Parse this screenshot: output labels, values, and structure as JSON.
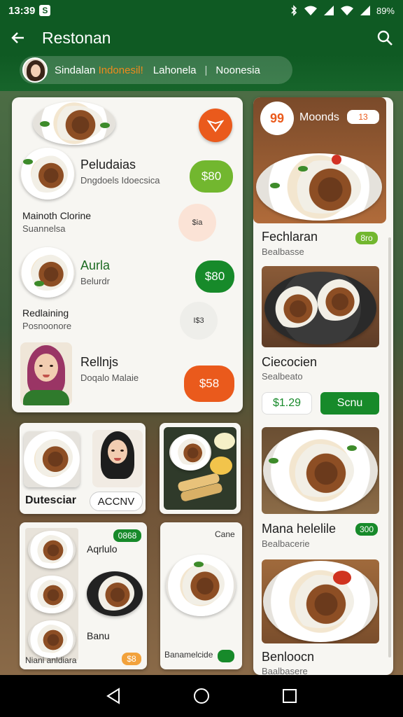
{
  "status_bar": {
    "time": "13:39",
    "badge": "S",
    "battery": "89%"
  },
  "app_bar": {
    "title": "Restonan"
  },
  "chip": {
    "prefix": "Sindalan",
    "highlight": "Indonesil!",
    "item2": "Lahonela",
    "separator": "|",
    "item3": "Noonesia"
  },
  "main_card": {
    "item1": {
      "title": "Peludaias",
      "subtitle": "Dngdoels Idoecsica",
      "price": "$80"
    },
    "label1": {
      "title": "Mainoth Clorine",
      "subtitle": "Suannelsa"
    },
    "badge1": "$ia",
    "item2": {
      "title": "Aurla",
      "subtitle": "Belurdr",
      "price": "$80"
    },
    "label2": {
      "title": "Redlaining",
      "subtitle": "Posnoonore"
    },
    "badge2": "I$3",
    "item3": {
      "title": "Rellnjs",
      "subtitle": "Doqalo Malaie",
      "price": "$58"
    }
  },
  "right_column": {
    "hero": {
      "price_circle": "99",
      "title": "Moonds",
      "tag": "13"
    },
    "item1": {
      "title": "Fechlaran",
      "subtitle": "Bealbasse",
      "tag": "8ro"
    },
    "item2": {
      "title": "Ciecocien",
      "subtitle": "Sealbeato",
      "price": "$1.29",
      "button": "Scnu"
    },
    "item3": {
      "title": "Mana helelile",
      "subtitle": "Bealbacerie",
      "tag": "300"
    },
    "item4": {
      "title": "Benloocn",
      "subtitle": "Baalbasere"
    }
  },
  "small_cards": {
    "card1": {
      "label": "Dutesciar",
      "button": "ACCNV"
    },
    "card3": {
      "badge": "0868",
      "title": "Aqrlulo",
      "label": "Banu",
      "footer": "Niani anldiara",
      "tag": "$8"
    },
    "card4": {
      "title": "Cane",
      "footer": "Banamelcide"
    }
  },
  "colors": {
    "brand_green": "#0f5a23",
    "orange": "#ea5a1c",
    "light_green": "#72b72f",
    "dark_green": "#178a2a"
  }
}
